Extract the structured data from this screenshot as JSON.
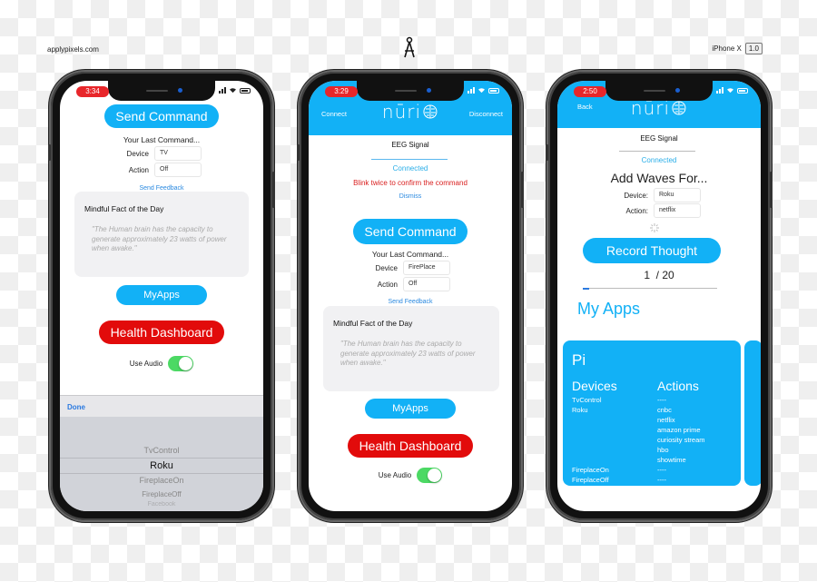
{
  "header": {
    "site": "applypixels.com",
    "device_label": "iPhone X",
    "version": "1.0",
    "logo_icon": "compass-icon"
  },
  "colors": {
    "accent": "#12b1f6",
    "danger": "#e20b0b",
    "status_pill": "#e8262a",
    "toggle_on": "#4cd964",
    "warning_text": "#d92020",
    "link": "#2b8ae0"
  },
  "phone1": {
    "time": "3:34",
    "send_command": "Send Command",
    "last_command_label": "Your Last Command...",
    "device_label": "Device",
    "device_value": "TV",
    "action_label": "Action",
    "action_value": "Off",
    "send_feedback": "Send Feedback",
    "fact_title": "Mindful Fact of the Day",
    "fact_quote": "\"The Human brain has the capacity to generate approximately 23 watts of power when awake.\"",
    "myapps": "MyApps",
    "health_dashboard": "Health Dashboard",
    "use_audio": "Use Audio",
    "use_audio_on": true,
    "picker_done": "Done",
    "picker_items": [
      "TvControl",
      "Roku",
      "FireplaceOn",
      "FireplaceOff",
      "Facebook"
    ],
    "picker_selected": "Roku"
  },
  "phone2": {
    "time": "3:29",
    "connect": "Connect",
    "disconnect": "Disconnect",
    "logo_text": "nūri",
    "eeg_signal": "EEG Signal",
    "connected": "Connected",
    "blink_warning": "Blink twice to confirm the command",
    "dismiss": "Dismiss",
    "send_command": "Send Command",
    "last_command_label": "Your Last Command...",
    "device_label": "Device",
    "device_value": "FirePlace",
    "action_label": "Action",
    "action_value": "Off",
    "send_feedback": "Send Feedback",
    "fact_title": "Mindful Fact of the Day",
    "fact_quote": "\"The Human brain has the capacity to generate approximately 23 watts of power when awake.\"",
    "myapps": "MyApps",
    "health_dashboard": "Health Dashboard",
    "use_audio": "Use Audio",
    "use_audio_on": true
  },
  "phone3": {
    "time": "2:50",
    "back": "Back",
    "logo_text": "nūri",
    "eeg_signal": "EEG Signal",
    "connected": "Connected",
    "add_waves": "Add Waves For...",
    "device_label": "Device:",
    "device_value": "Roku",
    "action_label": "Action:",
    "action_value": "netflix",
    "record_thought": "Record Thought",
    "progress_current": "1",
    "progress_total": "/ 20",
    "progress_fraction": 0.05,
    "my_apps_title": "My Apps",
    "card": {
      "title": "Pi",
      "devices_header": "Devices",
      "actions_header": "Actions",
      "devices": [
        "TvControl",
        "Roku",
        "",
        "",
        "",
        "",
        "",
        "FireplaceOn",
        "FireplaceOff"
      ],
      "actions": [
        "----",
        "cnbc",
        "netflix",
        "amazon prime",
        "curiosity stream",
        "hbo",
        "showtime",
        "----",
        "----"
      ]
    }
  }
}
